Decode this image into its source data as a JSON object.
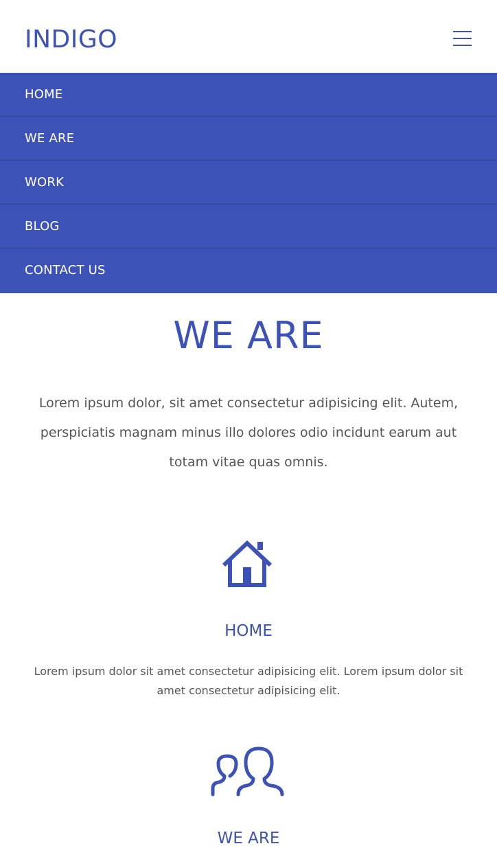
{
  "header": {
    "brand": "INDIGO",
    "menu_icon": "hamburger-menu-icon"
  },
  "menu": {
    "items": [
      {
        "label": "HOME"
      },
      {
        "label": "WE ARE"
      },
      {
        "label": "WORK"
      },
      {
        "label": "BLOG"
      },
      {
        "label": "CONTACT US"
      }
    ]
  },
  "section": {
    "title": "WE ARE",
    "intro": "Lorem ipsum dolor, sit amet consectetur adipisicing elit. Autem, perspiciatis magnam minus illo dolores odio incidunt earum aut totam vitae quas omnis."
  },
  "features": [
    {
      "icon": "house-icon",
      "title": "HOME",
      "text": "Lorem ipsum dolor sit amet consectetur adipisicing elit. Lorem ipsum dolor sit amet consectetur adipisicing elit."
    },
    {
      "icon": "people-icon",
      "title": "WE ARE"
    }
  ],
  "colors": {
    "accent": "#3d52b6",
    "text": "#555555",
    "background": "#ffffff",
    "menu_divider": "#2f418f"
  }
}
